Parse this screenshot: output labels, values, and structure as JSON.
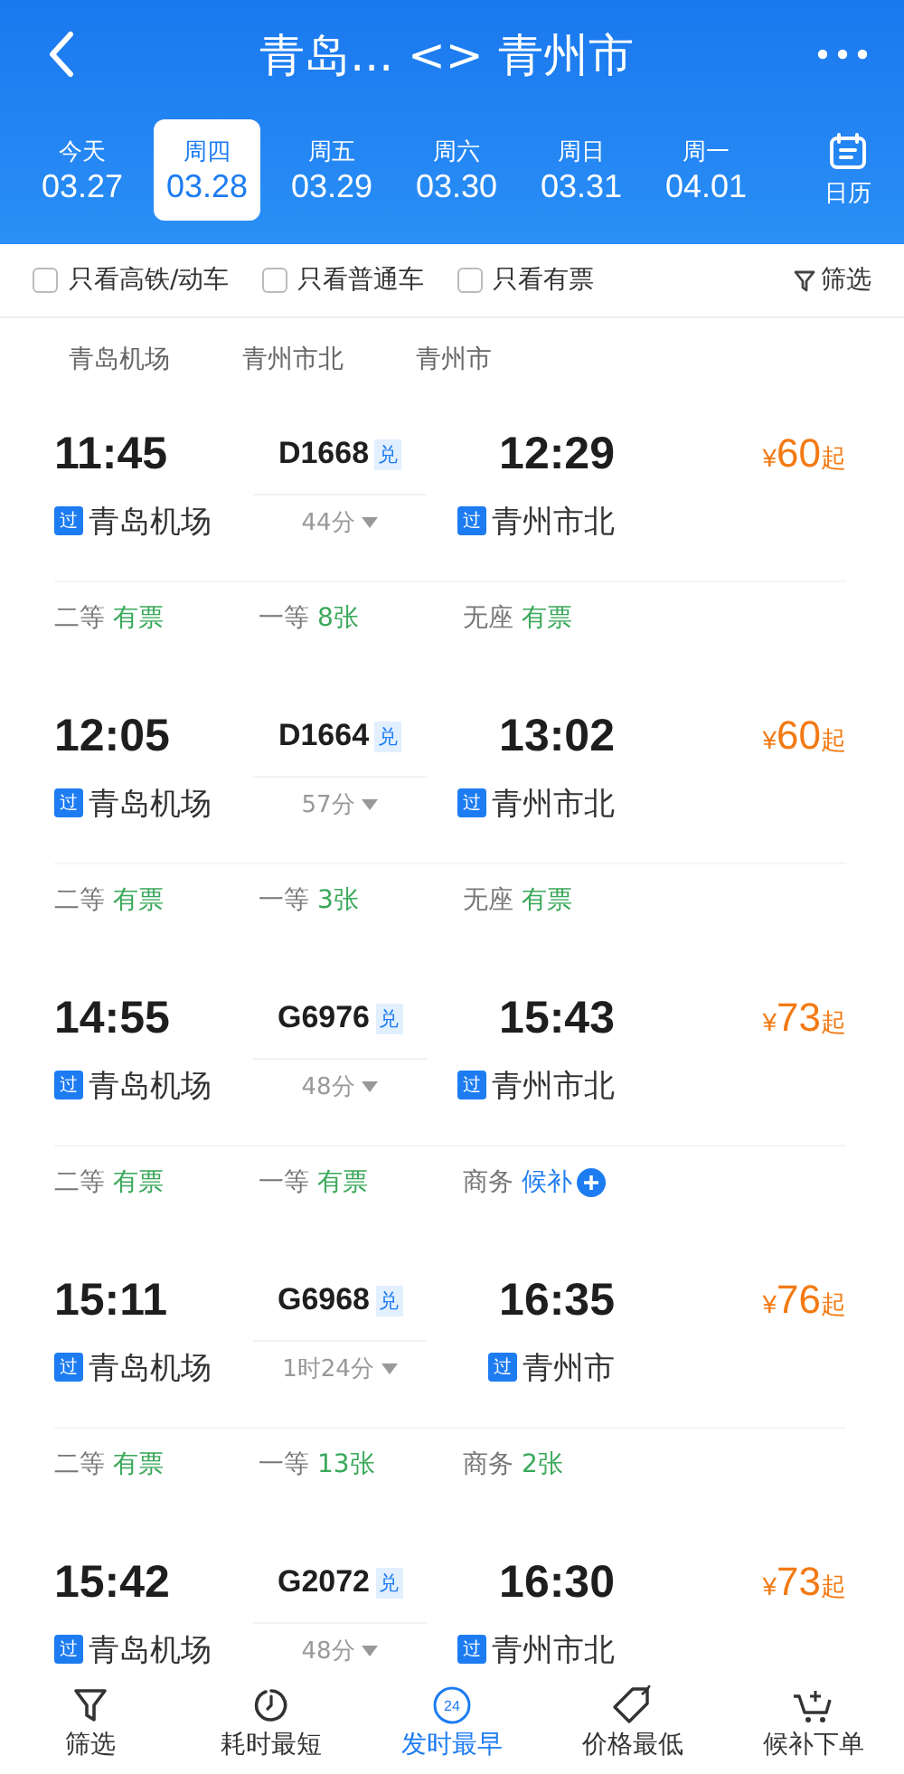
{
  "header": {
    "title": "青岛... <> 青州市"
  },
  "dates": [
    {
      "weekday": "今天",
      "date": "03.27",
      "selected": false
    },
    {
      "weekday": "周四",
      "date": "03.28",
      "selected": true
    },
    {
      "weekday": "周五",
      "date": "03.29",
      "selected": false
    },
    {
      "weekday": "周六",
      "date": "03.30",
      "selected": false
    },
    {
      "weekday": "周日",
      "date": "03.31",
      "selected": false
    },
    {
      "weekday": "周一",
      "date": "04.01",
      "selected": false
    }
  ],
  "calendar_label": "日历",
  "filters": [
    {
      "label": "只看高铁/动车",
      "checked": false
    },
    {
      "label": "只看普通车",
      "checked": false
    },
    {
      "label": "只看有票",
      "checked": false
    }
  ],
  "filter_button": "筛选",
  "stations": [
    "青岛机场",
    "青州市北",
    "青州市"
  ],
  "trains": [
    {
      "depart": "11:45",
      "train": "D1668",
      "badge": "兑",
      "arrive": "12:29",
      "from_tag": "过",
      "from": "青岛机场",
      "duration": "44分",
      "to_tag": "过",
      "to": "青州市北",
      "currency": "¥",
      "price": "60",
      "price_suffix": "起",
      "seats": [
        {
          "kind": "available",
          "cls": "二等",
          "status": "有票"
        },
        {
          "kind": "available",
          "cls": "一等",
          "status": "8张"
        },
        {
          "kind": "available",
          "cls": "无座",
          "status": "有票"
        }
      ]
    },
    {
      "depart": "12:05",
      "train": "D1664",
      "badge": "兑",
      "arrive": "13:02",
      "from_tag": "过",
      "from": "青岛机场",
      "duration": "57分",
      "to_tag": "过",
      "to": "青州市北",
      "currency": "¥",
      "price": "60",
      "price_suffix": "起",
      "seats": [
        {
          "kind": "available",
          "cls": "二等",
          "status": "有票"
        },
        {
          "kind": "available",
          "cls": "一等",
          "status": "3张"
        },
        {
          "kind": "available",
          "cls": "无座",
          "status": "有票"
        }
      ]
    },
    {
      "depart": "14:55",
      "train": "G6976",
      "badge": "兑",
      "arrive": "15:43",
      "from_tag": "过",
      "from": "青岛机场",
      "duration": "48分",
      "to_tag": "过",
      "to": "青州市北",
      "currency": "¥",
      "price": "73",
      "price_suffix": "起",
      "seats": [
        {
          "kind": "available",
          "cls": "二等",
          "status": "有票"
        },
        {
          "kind": "available",
          "cls": "一等",
          "status": "有票"
        },
        {
          "kind": "waitlist",
          "cls": "商务",
          "status": "候补"
        }
      ]
    },
    {
      "depart": "15:11",
      "train": "G6968",
      "badge": "兑",
      "arrive": "16:35",
      "from_tag": "过",
      "from": "青岛机场",
      "duration": "1时24分",
      "to_tag": "过",
      "to": "青州市",
      "currency": "¥",
      "price": "76",
      "price_suffix": "起",
      "seats": [
        {
          "kind": "available",
          "cls": "二等",
          "status": "有票"
        },
        {
          "kind": "available",
          "cls": "一等",
          "status": "13张"
        },
        {
          "kind": "available",
          "cls": "商务",
          "status": "2张"
        }
      ]
    },
    {
      "depart": "15:42",
      "train": "G2072",
      "badge": "兑",
      "arrive": "16:30",
      "from_tag": "过",
      "from": "青岛机场",
      "duration": "48分",
      "to_tag": "过",
      "to": "青州市北",
      "currency": "¥",
      "price": "73",
      "price_suffix": "起"
    }
  ],
  "tabs": [
    {
      "kind": "filter",
      "label": "筛选",
      "selected": false
    },
    {
      "kind": "timer",
      "label": "耗时最短",
      "selected": false
    },
    {
      "kind": "clock",
      "label": "发时最早",
      "icon_text": "24",
      "selected": true
    },
    {
      "kind": "tag",
      "label": "价格最低",
      "selected": false
    },
    {
      "kind": "cart",
      "label": "候补下单",
      "selected": false
    }
  ]
}
